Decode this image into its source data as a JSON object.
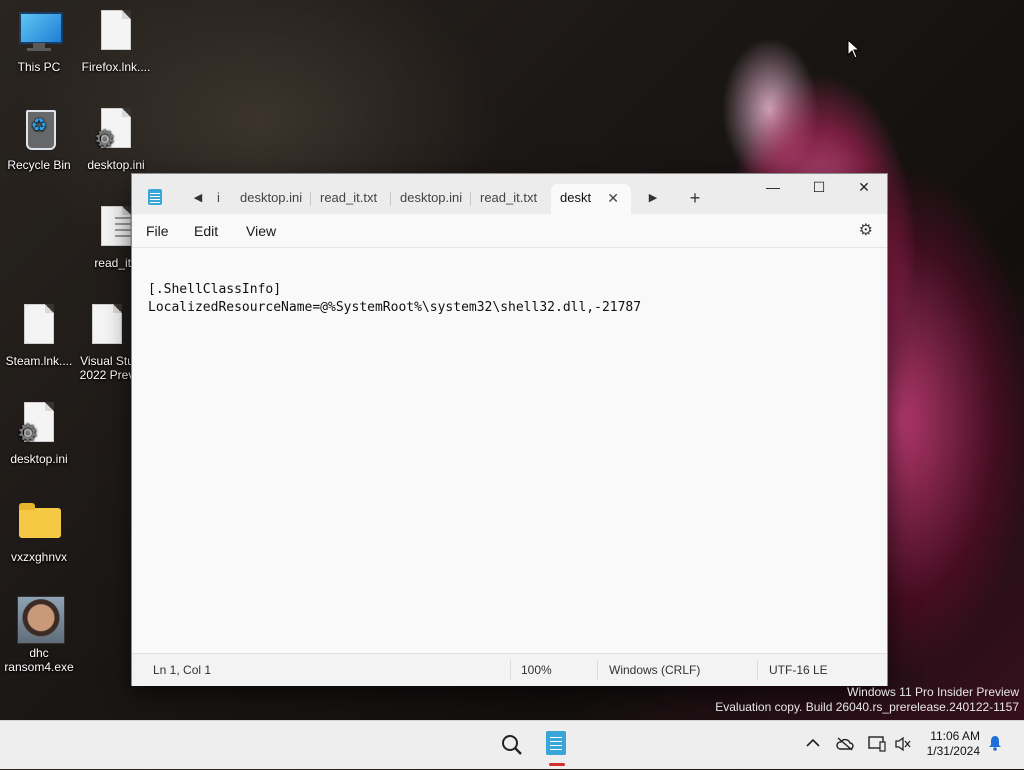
{
  "desktop": {
    "icons": [
      {
        "label": "This PC",
        "icon": "monitor-icon"
      },
      {
        "label": "Firefox.lnk....",
        "icon": "file-icon"
      },
      {
        "label": "Recycle Bin",
        "icon": "recycle-bin-icon"
      },
      {
        "label": "desktop.ini",
        "icon": "settings-file-icon"
      },
      {
        "label": "read_it.t",
        "icon": "text-file-icon"
      },
      {
        "label": "Steam.lnk....",
        "icon": "file-icon"
      },
      {
        "label": "Visual Stu 2022 Prev",
        "icon": "file-icon"
      },
      {
        "label": "desktop.ini",
        "icon": "settings-file-icon"
      },
      {
        "label": "vxzxghnvx",
        "icon": "folder-icon"
      },
      {
        "label": "dhc ransom4.exe",
        "icon": "photo-icon"
      }
    ]
  },
  "notepad": {
    "tabs": [
      {
        "label": "i"
      },
      {
        "label": "desktop.ini"
      },
      {
        "label": "read_it.txt"
      },
      {
        "label": "desktop.ini"
      },
      {
        "label": "read_it.txt"
      },
      {
        "label": "deskt",
        "active": true
      }
    ],
    "new_tab": "+",
    "controls": {
      "minimize": "—",
      "maximize": "☐",
      "close": "✕"
    },
    "menu": {
      "file": "File",
      "edit": "Edit",
      "view": "View"
    },
    "content_line1": "[.ShellClassInfo]",
    "content_line2": "LocalizedResourceName=@%SystemRoot%\\system32\\shell32.dll,-21787",
    "status": {
      "position": "Ln 1, Col 1",
      "zoom": "100%",
      "line_ending": "Windows (CRLF)",
      "encoding": "UTF-16 LE"
    }
  },
  "watermark": {
    "line1": "Windows 11 Pro Insider Preview",
    "line2": "Evaluation copy. Build 26040.rs_prerelease.240122-1157"
  },
  "taskbar": {
    "time": "11:06 AM",
    "date": "1/31/2024"
  },
  "colors": {
    "accent": "#1b6fd6",
    "notepad_icon": "#3aa6d8",
    "taskbar_indicator": "#d42e2e"
  }
}
